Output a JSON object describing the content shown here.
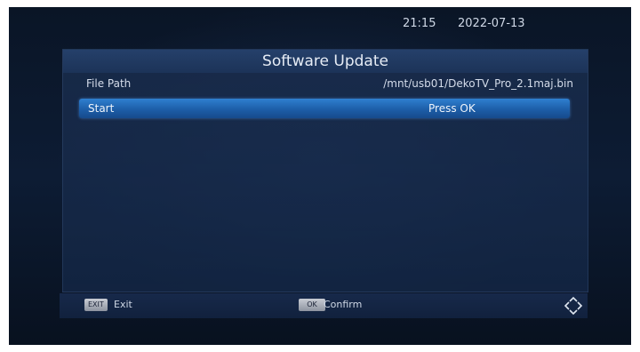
{
  "status": {
    "time": "21:15",
    "date": "2022-07-13"
  },
  "panel": {
    "title": "Software Update",
    "rows": [
      {
        "label": "File Path",
        "value": "/mnt/usb01/DekoTV_Pro_2.1maj.bin"
      },
      {
        "label": "Start",
        "value": "Press OK"
      }
    ]
  },
  "footer": {
    "exit_key": "EXIT",
    "exit_label": "Exit",
    "ok_key": "OK",
    "ok_label": "Confirm",
    "nav_icon": "navigation-arrows-icon"
  },
  "colors": {
    "highlight": "#1d5ea8",
    "panel": "#1c3358"
  }
}
